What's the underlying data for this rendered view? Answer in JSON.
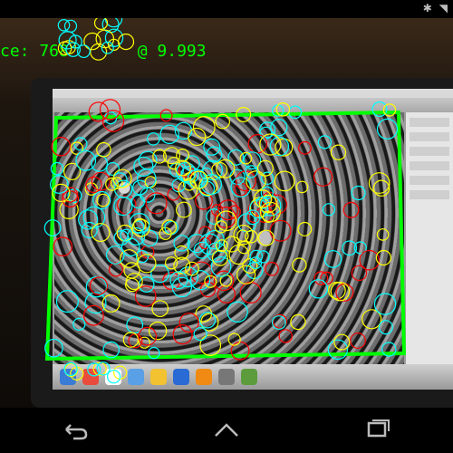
{
  "status_bar": {
    "icons": [
      "bluetooth-icon",
      "wifi-icon"
    ]
  },
  "hud": {
    "detection_text": "ce: 768",
    "scale_text": "@ 9.993",
    "colors": {
      "text": "#00ff00",
      "bounding_box": "#00ff00"
    }
  },
  "overlay": {
    "feature_colors": [
      "#00ffff",
      "#ffff00",
      "#ff0000"
    ]
  },
  "dock_icons": [
    "finder-icon",
    "chrome-icon",
    "calendar-icon",
    "mail-icon",
    "photos-icon",
    "vs-code-icon",
    "vlc-icon",
    "preferences-icon",
    "app-icon"
  ],
  "navbar": {
    "buttons": [
      "back-button",
      "home-button",
      "recents-button"
    ]
  }
}
